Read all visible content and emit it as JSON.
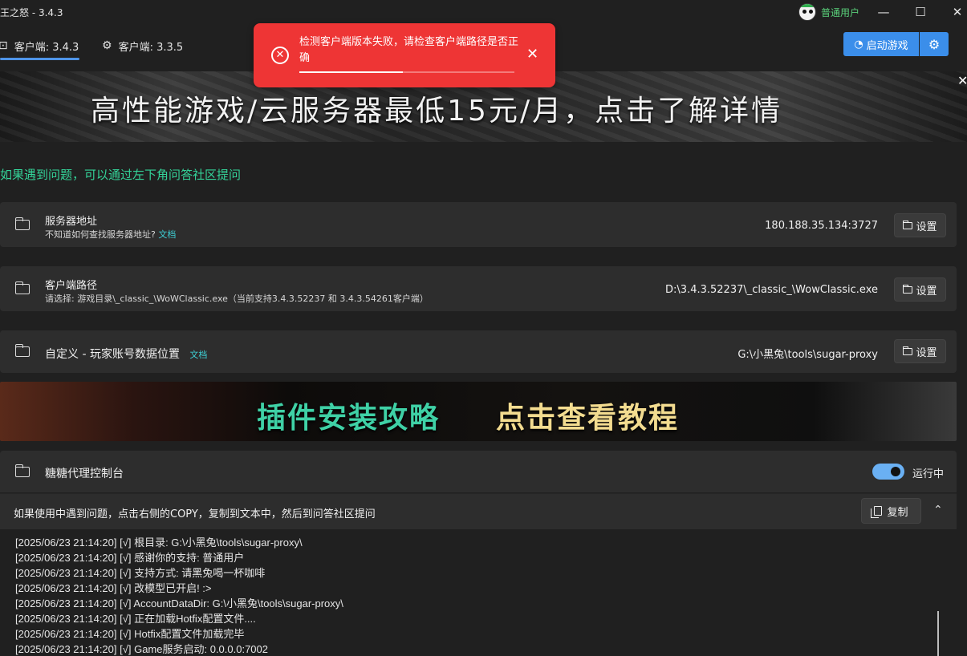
{
  "window": {
    "title": "王之怒 - 3.4.3",
    "user_label": "普通用户",
    "minimize": "—",
    "maximize": "☐",
    "close": "✕"
  },
  "tabs": [
    {
      "label": "客户端: 3.4.3",
      "icon": "tab-icon"
    },
    {
      "label": "客户端: 3.3.5",
      "icon": "gear-icon"
    }
  ],
  "toolbar": {
    "start_label": "启动游戏",
    "accent": "#3b8eea"
  },
  "toast": {
    "message": "检测客户端版本失败，请检查客户端路径是否正确",
    "progress": 0.48,
    "color": "#ee3535"
  },
  "banner_top": {
    "text": "高性能游戏/云服务器最低15元/月，点击了解详情"
  },
  "info": {
    "text": "如果遇到问题，可以通过左下角问答社区提问"
  },
  "server": {
    "title": "服务器地址",
    "sub": "不知道如何查找服务器地址?",
    "link": "文档",
    "value": "180.188.35.134:3727",
    "button": "设置"
  },
  "client_path": {
    "title": "客户端路径",
    "sub": "请选择: 游戏目录\\_classic_\\WoWClassic.exe（当前支持3.4.3.52237 和 3.4.3.54261客户端）",
    "value": "D:\\3.4.3.52237\\_classic_\\WowClassic.exe",
    "button": "设置"
  },
  "account_data": {
    "title": "自定义 - 玩家账号数据位置",
    "link": "文档",
    "value": "G:\\小黑兔\\tools\\sugar-proxy",
    "button": "设置"
  },
  "banner_mid": {
    "text1": "插件安装攻略",
    "text2": "点击查看教程"
  },
  "console": {
    "title": "糖糖代理控制台",
    "status": "运行中",
    "running": true,
    "hint": "如果使用中遇到问题，点击右侧的COPY，复制到文本中，然后到问答社区提问",
    "copy_label": "复制",
    "lines": [
      "[2025/06/23 21:14:20] [√] 根目录: G:\\小黑兔\\tools\\sugar-proxy\\",
      "[2025/06/23 21:14:20] [√] 感谢你的支持: 普通用户",
      "[2025/06/23 21:14:20] [√] 支持方式: 请黑兔喝一杯咖啡",
      "[2025/06/23 21:14:20] [√] 改模型已开启! :>",
      "[2025/06/23 21:14:20] [√] AccountDataDir: G:\\小黑兔\\tools\\sugar-proxy\\",
      "[2025/06/23 21:14:20] [√] 正在加载Hotfix配置文件....",
      "[2025/06/23 21:14:20] [√] Hotfix配置文件加载完毕",
      "[2025/06/23 21:14:20] [√] Game服务启动: 0.0.0.0:7002"
    ]
  }
}
